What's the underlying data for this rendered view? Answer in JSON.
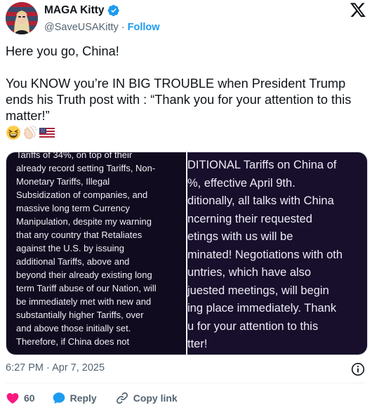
{
  "author": {
    "name": "MAGA Kitty",
    "handle": "@SaveUSAKitty",
    "separator": "·",
    "follow_label": "Follow"
  },
  "tweet": {
    "line1": "Here you go, China!",
    "line2": "You KNOW you’re IN BIG TROUBLE when President Trump ends his Truth post with : “Thank you for your attention to this matter!”",
    "emoji_icons": [
      "grinning-squinting-face-icon",
      "clapping-hands-icon",
      "us-flag-icon"
    ]
  },
  "media": {
    "left_lines": [
      "Tariffs of 34%, on top of their",
      "already record setting Tariffs, Non-",
      "Monetary Tariffs, Illegal",
      "Subsidization of companies, and",
      "massive long term Currency",
      "Manipulation, despite my warning",
      "that any country that Retaliates",
      "against the U.S. by issuing",
      "additional Tariffs, above and",
      "beyond their already existing long",
      "term Tariff abuse of our Nation, will",
      "be immediately met with new and",
      "substantially higher Tariffs, over",
      "and above those initially set.",
      "Therefore, if China does not"
    ],
    "right_lines": [
      "DITIONAL Tariffs on China of",
      "%, effective April 9th.",
      "ditionally, all talks with China",
      "ncerning their requested",
      "etings with us will be",
      "minated! Negotiations with oth",
      "untries, which have also",
      "juested meetings, will begin",
      "ing place immediately. Thank",
      "u for your attention to this",
      "tter!"
    ]
  },
  "meta": {
    "timestamp": "6:27 PM · Apr 7, 2025"
  },
  "actions": {
    "like_count": "60",
    "reply_label": "Reply",
    "copy_link_label": "Copy link"
  },
  "colors": {
    "accent": "#1d9bf0",
    "like": "#f91880",
    "text_secondary": "#536471",
    "media_bg": "#110b1f"
  }
}
